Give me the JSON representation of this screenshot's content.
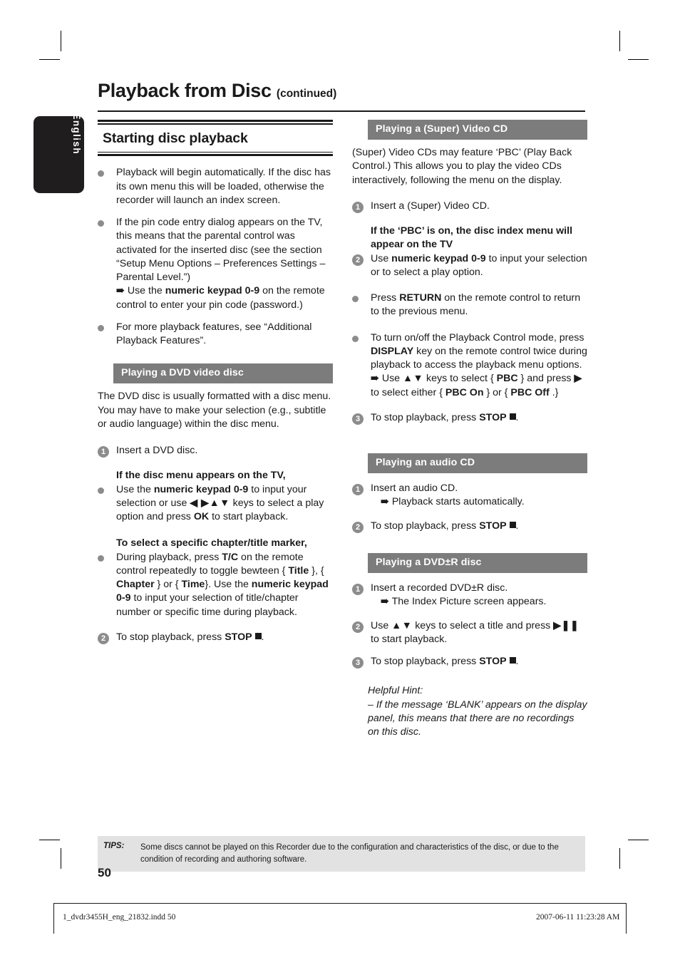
{
  "page": {
    "title": "Playback from Disc",
    "title_suffix": "(continued)",
    "language_tab": "English",
    "page_number": "50"
  },
  "left_column": {
    "section_title": "Starting disc playback",
    "bullets": [
      "Playback will begin automatically. If the disc has its own menu this will be loaded, otherwise the recorder will launch an index screen.",
      "If the pin code entry dialog appears on the TV, this means that the parental control was activated for the inserted disc (see the section “Setup Menu Options – Preferences Settings – Parental Level.”)",
      "For more playback features, see “Additional Playback Features”."
    ],
    "pin_arrow_pre": "Use the ",
    "pin_arrow_bold": "numeric keypad 0-9",
    "pin_arrow_post": " on the remote control to enter your pin code (password.)",
    "dvd_video": {
      "band": "Playing a DVD video disc",
      "intro": "The DVD disc is usually formatted with a disc menu. You may have to make your selection (e.g., subtitle or audio language) within the disc menu.",
      "step1": "Insert a DVD disc.",
      "subhead1": "If the disc menu appears on the TV,",
      "bullet1_a": "Use the ",
      "bullet1_b": "numeric keypad 0-9",
      "bullet1_c": " to input your selection or use ",
      "bullet1_keys": "◀ ▶▲▼",
      "bullet1_d": " keys to select a play option and press ",
      "bullet1_e": "OK",
      "bullet1_f": " to start playback.",
      "subhead2": "To select a specific chapter/title marker,",
      "bullet2_a": "During playback, press ",
      "bullet2_b": "T/C",
      "bullet2_c": " on the remote control repeatedly to toggle bewteen { ",
      "bullet2_title": "Title",
      "bullet2_d": " }, { ",
      "bullet2_chapter": "Chapter",
      "bullet2_e": " } or { ",
      "bullet2_time": "Time",
      "bullet2_f": "}. Use the ",
      "bullet2_g": "numeric keypad 0-9",
      "bullet2_h": " to input your selection of title/chapter number or specific time during playback.",
      "step2_a": "To stop playback, press ",
      "step2_b": "STOP"
    }
  },
  "right_column": {
    "super_video_cd": {
      "band": "Playing a (Super) Video CD",
      "intro": "(Super) Video CDs may feature ‘PBC’ (Play Back Control.) This allows you to play the video CDs interactively, following the menu on the display.",
      "step1": "Insert a (Super) Video CD.",
      "subhead": "If the ‘PBC’ is on, the disc index menu will appear on the TV",
      "step2_a": "Use ",
      "step2_b": "numeric keypad 0-9",
      "step2_c": " to input your selection or to select a play option.",
      "bullet_return_a": "Press ",
      "bullet_return_b": "RETURN",
      "bullet_return_c": " on the remote control to return to the previous menu.",
      "bullet_pbc_a": "To turn on/off the Playback Control mode, press ",
      "bullet_pbc_b": "DISPLAY",
      "bullet_pbc_c": " key on the remote control twice during playback to access the playback menu options.",
      "pbc_arrow_a": "Use ",
      "pbc_arrow_keys": "▲▼",
      "pbc_arrow_b": " keys to select { ",
      "pbc_label": "PBC",
      "pbc_arrow_c": " } and press ",
      "pbc_right_key": "▶",
      "pbc_arrow_d": " to select either { ",
      "pbc_on": "PBC On",
      "pbc_arrow_e": " } or { ",
      "pbc_off": "PBC Off",
      "pbc_arrow_f": " .}",
      "step3_a": "To stop playback, press ",
      "step3_b": "STOP"
    },
    "audio_cd": {
      "band": "Playing an audio CD",
      "step1": "Insert an audio CD.",
      "step1_arrow": "Playback starts automatically.",
      "step2_a": "To stop playback, press ",
      "step2_b": "STOP"
    },
    "dvd_r": {
      "band": "Playing a DVD±R disc",
      "step1": "Insert a recorded DVD±R disc.",
      "step1_arrow": "The Index Picture screen appears.",
      "step2_a": "Use ",
      "step2_keys": "▲▼",
      "step2_b": " keys to select a title and press ",
      "step2_playpause": "▶❚❚",
      "step2_c": " to start playback.",
      "step3_a": "To stop playback, press ",
      "step3_b": "STOP",
      "hint_title": "Helpful Hint:",
      "hint_body": "– If the message ‘BLANK’ appears on the display panel, this means that there are no recordings on this disc."
    }
  },
  "tips": {
    "label": "TIPS:",
    "text": "Some discs cannot be played on this Recorder due to the configuration and characteristics of the disc, or due to the condition of recording and authoring software."
  },
  "footer": {
    "left": "1_dvdr3455H_eng_21832.indd   50",
    "right": "2007-06-11   11:23:28 AM"
  },
  "colors": {
    "band_gray": "#7c7c7c",
    "marker_gray": "#8c8c8c",
    "tab_black": "#201d1e",
    "tips_gray": "#e2e2e2"
  }
}
